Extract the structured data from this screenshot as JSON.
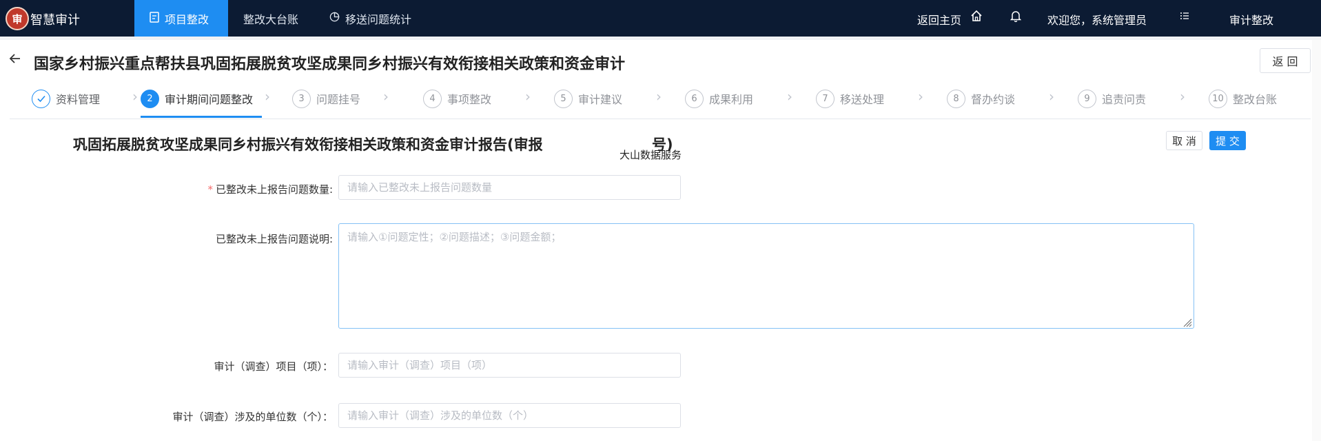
{
  "app": {
    "logo_text": "审",
    "brand": "智慧审计",
    "nav": [
      {
        "label": "项目整改",
        "icon": "document-icon"
      },
      {
        "label": "整改大台账",
        "icon": ""
      },
      {
        "label": "移送问题统计",
        "icon": "pie-chart-icon"
      }
    ],
    "home_link": "返回主页",
    "welcome": "欢迎您，系统管理员",
    "module": "审计整改"
  },
  "page": {
    "title": "国家乡村振兴重点帮扶县巩固拓展脱贫攻坚成果同乡村振兴有效衔接相关政策和资金审计",
    "return_label": "返 回"
  },
  "steps": [
    {
      "num": "✓",
      "label": "资料管理",
      "state": "done"
    },
    {
      "num": "2",
      "label": "审计期间问题整改",
      "state": "active"
    },
    {
      "num": "3",
      "label": "问题挂号",
      "state": "todo"
    },
    {
      "num": "4",
      "label": "事项整改",
      "state": "todo"
    },
    {
      "num": "5",
      "label": "审计建议",
      "state": "todo"
    },
    {
      "num": "6",
      "label": "成果利用",
      "state": "todo"
    },
    {
      "num": "7",
      "label": "移送处理",
      "state": "todo"
    },
    {
      "num": "8",
      "label": "督办约谈",
      "state": "todo"
    },
    {
      "num": "9",
      "label": "追责问责",
      "state": "todo"
    },
    {
      "num": "10",
      "label": "整改台账",
      "state": "todo"
    }
  ],
  "form": {
    "title": "巩固拓展脱贫攻坚成果同乡村振兴有效衔接相关政策和资金审计报告(审报",
    "title_tail": "号)",
    "watermark": "大山数据服务",
    "cancel_label": "取 消",
    "submit_label": "提 交",
    "required_mark": "*",
    "fields": [
      {
        "label": "已整改未上报告问题数量:",
        "placeholder": "请输入已整改未上报告问题数量",
        "value": "",
        "required": true
      },
      {
        "label": "已整改未上报告问题说明:",
        "placeholder": "请输入①问题定性；②问题描述；③问题金额；",
        "value": ""
      },
      {
        "label": "审计（调查）项目（项）：",
        "placeholder": "请输入审计（调查）项目（项）",
        "value": ""
      },
      {
        "label": "审计（调查）涉及的单位数（个）：",
        "placeholder": "请输入审计（调查）涉及的单位数（个）",
        "value": ""
      }
    ]
  },
  "colors": {
    "topbar": "#0c1b33",
    "accent": "#1e8df2",
    "required": "#f56c6c"
  }
}
